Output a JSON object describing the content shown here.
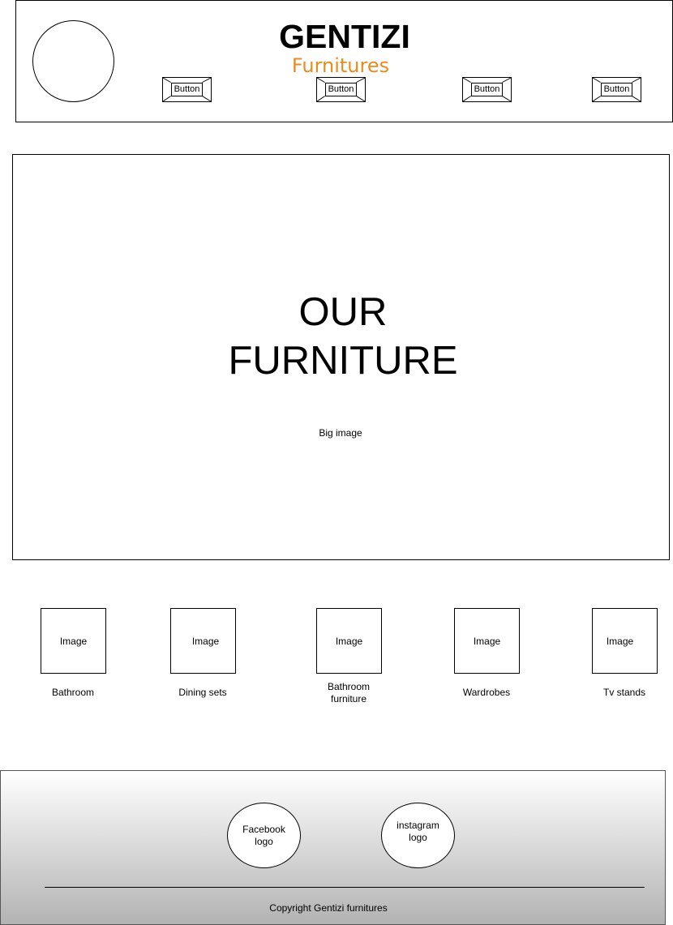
{
  "header": {
    "brand_title": "GENTIZI",
    "brand_subtitle": "Furnitures",
    "brand_subtitle_color": "#e98b1f",
    "nav_buttons": [
      {
        "label": "Button"
      },
      {
        "label": "Button"
      },
      {
        "label": "Button"
      },
      {
        "label": "Button"
      }
    ]
  },
  "hero": {
    "title_line1": "OUR",
    "title_line2": "FURNITURE",
    "caption": "Big image"
  },
  "categories": [
    {
      "image_text": "Image",
      "label": "Bathroom"
    },
    {
      "image_text": "Image",
      "label": "Dining sets"
    },
    {
      "image_text": "Image",
      "label_line1": "Bathroom",
      "label_line2": "furniture"
    },
    {
      "image_text": "Image",
      "label": "Wardrobes"
    },
    {
      "image_text": "Image",
      "label": "Tv stands"
    }
  ],
  "footer": {
    "facebook_line1": "Facebook",
    "facebook_line2": "logo",
    "instagram_line1": "instagram",
    "instagram_line2": "logo",
    "copyright": "Copyright Gentizi furnitures"
  }
}
